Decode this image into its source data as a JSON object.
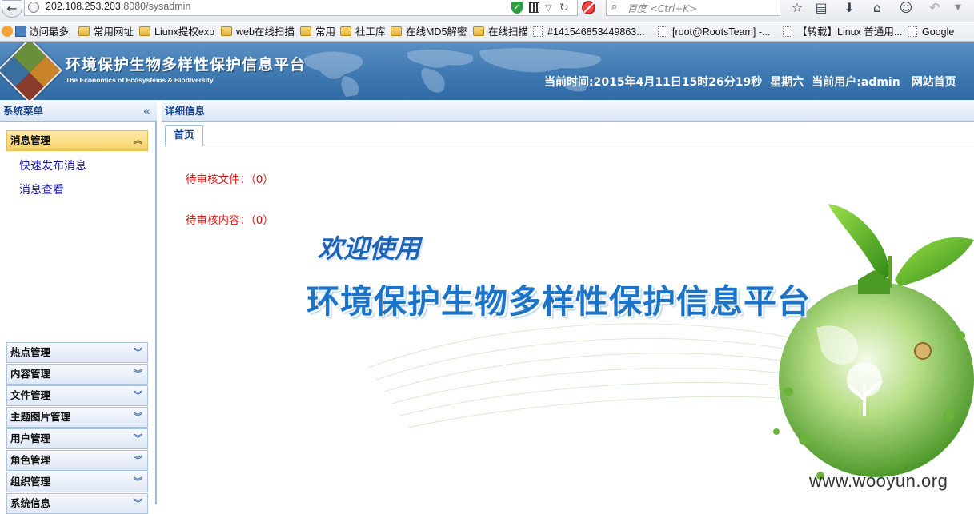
{
  "browser": {
    "url_host": "202.108.253.203",
    "url_path": ":8080/sysadmin",
    "search_placeholder": "百度 <Ctrl+K>",
    "back_glyph": "←",
    "reload_glyph": "↻",
    "bookmarks": [
      {
        "label": "访问最多",
        "type": "special"
      },
      {
        "label": "常用网址",
        "type": "folder"
      },
      {
        "label": "Liunx提权exp",
        "type": "folder"
      },
      {
        "label": "web在线扫描",
        "type": "folder"
      },
      {
        "label": "常用",
        "type": "folder"
      },
      {
        "label": "社工库",
        "type": "folder"
      },
      {
        "label": "在线MD5解密",
        "type": "folder"
      },
      {
        "label": "在线扫描",
        "type": "folder"
      },
      {
        "label": "#141546853449863...",
        "type": "page"
      },
      {
        "label": "[root@RootsTeam] -...",
        "type": "page"
      },
      {
        "label": "【转载】Linux 普通用...",
        "type": "page"
      },
      {
        "label": "Google",
        "type": "page"
      }
    ]
  },
  "header": {
    "title": "环境保护生物多样性保护信息平台",
    "subtitle": "The Economics of Ecosystems & Biodiversity",
    "time_label": "当前时间:",
    "time_value": "2015年4月11日15时26分19秒",
    "weekday": "星期六",
    "user_label": "当前用户:",
    "user_value": "admin",
    "home_link": "网站首页"
  },
  "sidebar": {
    "title": "系统菜单",
    "collapse_glyph": "«",
    "active_section": {
      "label": "消息管理",
      "links": [
        "快速发布消息",
        "消息查看"
      ]
    },
    "sections": [
      "热点管理",
      "内容管理",
      "文件管理",
      "主题图片管理",
      "用户管理",
      "角色管理",
      "组织管理",
      "系统信息"
    ]
  },
  "main": {
    "title": "详细信息",
    "tabs": [
      "首页"
    ],
    "pending_files": "待审核文件：（0）",
    "pending_content": "待审核内容：（0）",
    "welcome": "欢迎使用",
    "banner_title": "环境保护生物多样性保护信息平台",
    "watermark": "www.wooyun.org"
  },
  "colors": {
    "header_blue": "#3f79b2",
    "panel_border": "#99bbe8",
    "active_section": "#f7d26a",
    "pending_text": "#e01010",
    "banner_text": "#1c74c9"
  }
}
